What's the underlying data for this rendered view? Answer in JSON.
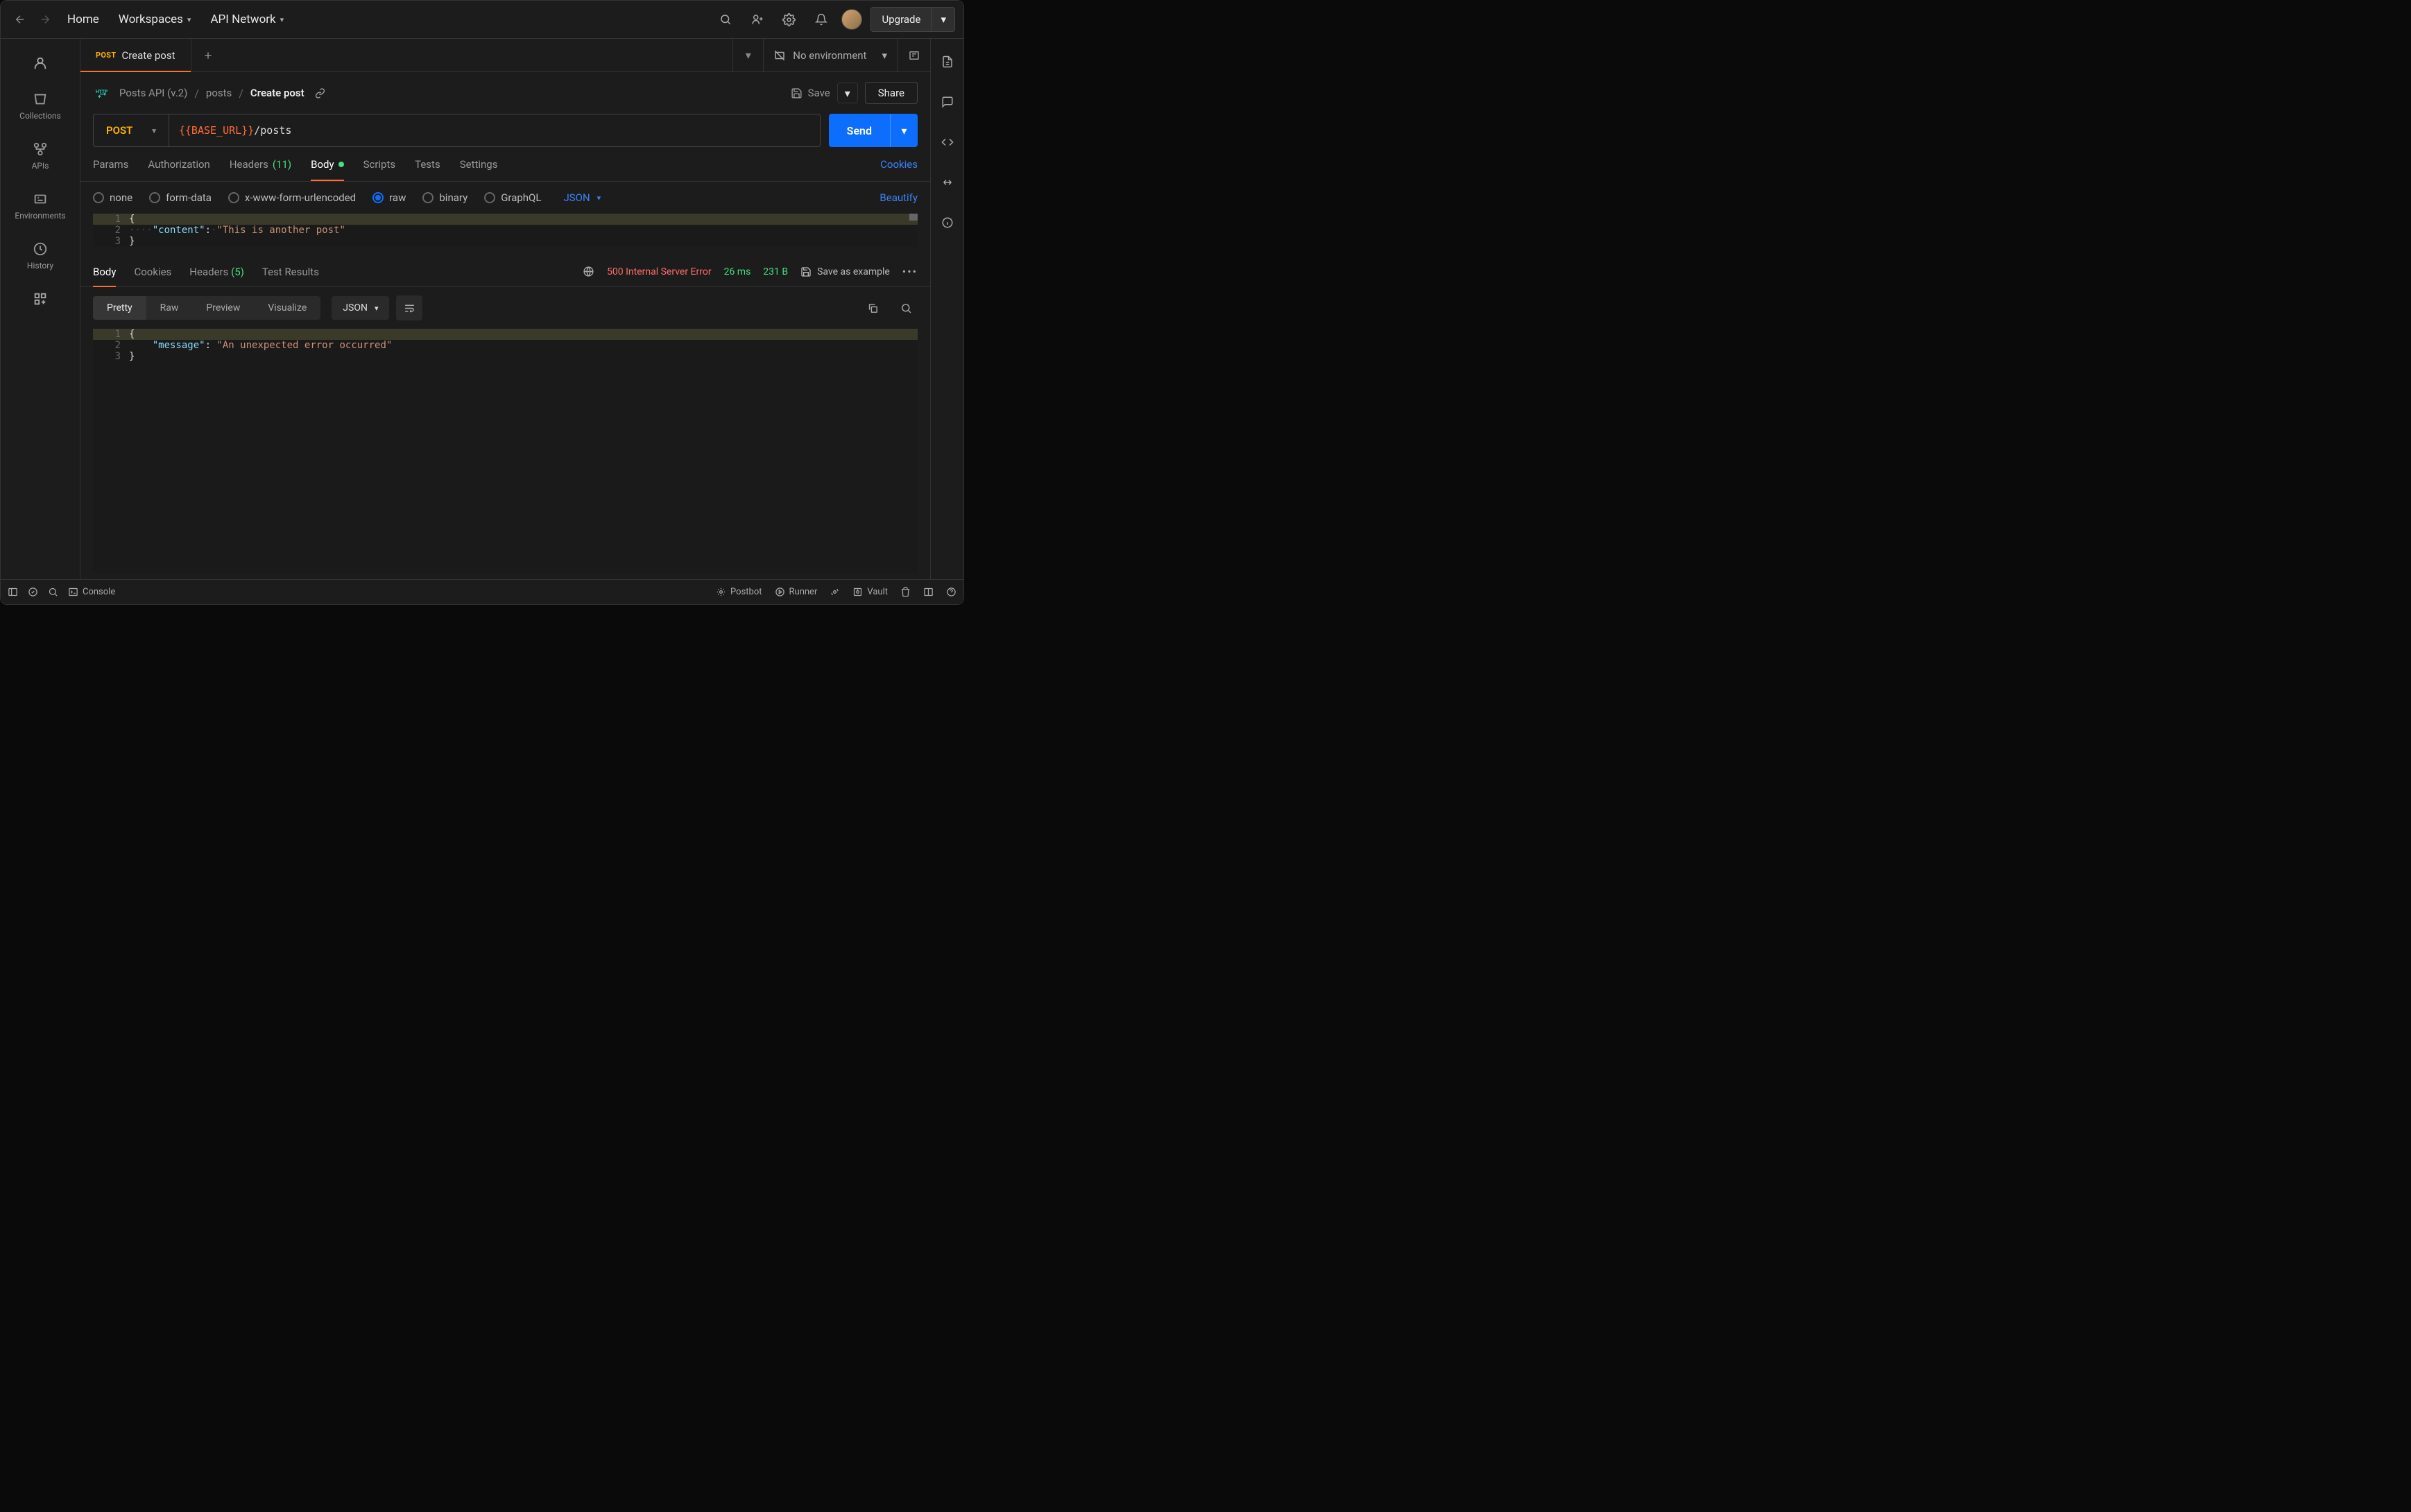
{
  "header": {
    "home": "Home",
    "workspaces": "Workspaces",
    "api_network": "API Network",
    "upgrade": "Upgrade"
  },
  "sidebar": {
    "collections": "Collections",
    "apis": "APIs",
    "environments": "Environments",
    "history": "History"
  },
  "tabs": {
    "active_method": "POST",
    "active_title": "Create post"
  },
  "environment": {
    "label": "No environment"
  },
  "breadcrumb": {
    "http": "HTTP",
    "collection": "Posts API (v.2)",
    "folder": "posts",
    "request": "Create post",
    "save": "Save",
    "share": "Share"
  },
  "url": {
    "method": "POST",
    "var": "{{BASE_URL}}",
    "path": "/posts",
    "send": "Send"
  },
  "req_tabs": {
    "params": "Params",
    "auth": "Authorization",
    "headers_label": "Headers",
    "headers_count": "(11)",
    "body": "Body",
    "scripts": "Scripts",
    "tests": "Tests",
    "settings": "Settings",
    "cookies": "Cookies"
  },
  "body_types": {
    "none": "none",
    "form_data": "form-data",
    "urlencoded": "x-www-form-urlencoded",
    "raw": "raw",
    "binary": "binary",
    "graphql": "GraphQL",
    "json": "JSON",
    "beautify": "Beautify"
  },
  "request_body": {
    "line1": "{",
    "line2_key": "\"content\"",
    "line2_val": "\"This is another post\"",
    "line3": "}"
  },
  "resp_tabs": {
    "body": "Body",
    "cookies": "Cookies",
    "headers_label": "Headers",
    "headers_count": "(5)",
    "test_results": "Test Results"
  },
  "resp_meta": {
    "status": "500 Internal Server Error",
    "time": "26 ms",
    "size": "231 B",
    "save_example": "Save as example"
  },
  "resp_toolbar": {
    "pretty": "Pretty",
    "raw": "Raw",
    "preview": "Preview",
    "visualize": "Visualize",
    "json": "JSON"
  },
  "response_body": {
    "line1": "{",
    "line2_key": "\"message\"",
    "line2_val": "\"An unexpected error occurred\"",
    "line3": "}"
  },
  "footer": {
    "console": "Console",
    "postbot": "Postbot",
    "runner": "Runner",
    "vault": "Vault"
  }
}
